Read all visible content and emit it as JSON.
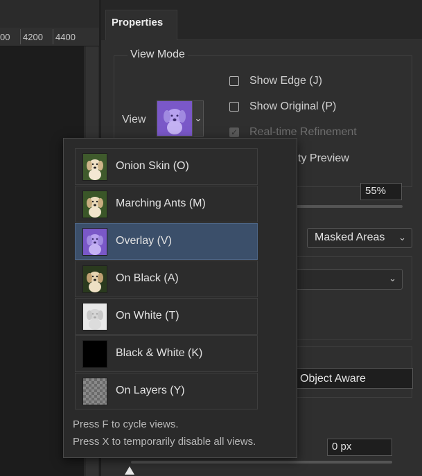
{
  "ruler": {
    "ticks": [
      "00",
      "4200",
      "4400"
    ]
  },
  "panel": {
    "tab_label": "Properties"
  },
  "view_mode": {
    "title": "View Mode",
    "view_label": "View",
    "show_edge": "Show Edge (J)",
    "show_original": "Show Original (P)",
    "realtime_refinement": "Real-time Refinement",
    "quality_preview_partial": "ality Preview"
  },
  "fields": {
    "opacity_value": "55%",
    "show_selector": "Masked Areas",
    "mode_value": "Object Aware",
    "radius_value": "0 px"
  },
  "dropdown": {
    "items": [
      {
        "label": "Onion Skin (O)",
        "thumb": "dog-onion"
      },
      {
        "label": "Marching Ants (M)",
        "thumb": "dog-ants"
      },
      {
        "label": "Overlay (V)",
        "thumb": "dog-overlay"
      },
      {
        "label": "On Black (A)",
        "thumb": "dog-black"
      },
      {
        "label": "On White (T)",
        "thumb": "dog-white"
      },
      {
        "label": "Black & White (K)",
        "thumb": "black-white"
      },
      {
        "label": "On Layers (Y)",
        "thumb": "checker"
      }
    ],
    "selected_index": 2,
    "hint1": "Press F to cycle views.",
    "hint2": "Press X to temporarily disable all views."
  },
  "colors": {
    "selection": "#3b4f6a",
    "overlay": "#8e6ad8"
  }
}
